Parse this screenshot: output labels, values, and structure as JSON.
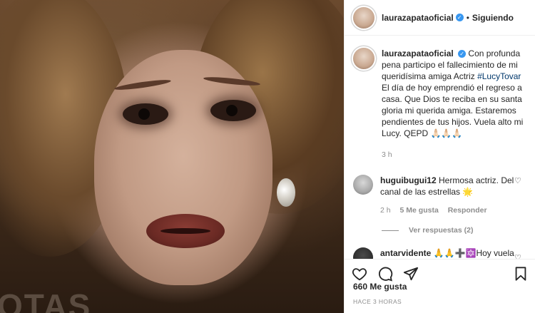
{
  "post": {
    "username": "laurazapataoficial",
    "follow_status": "Siguiendo",
    "dot": "•",
    "photo_watermark": "OTAS"
  },
  "caption": {
    "username": "laurazapataoficial",
    "text_before_tag": "Con profunda pena participo el fallecimiento de mi queridísima amiga Actriz ",
    "tag": "#LucyTovar",
    "text_after_tag": " El día de hoy emprendió el regreso a casa. Que Dios te reciba en su santa gloria mi querida amiga. Estaremos pendientes de tus hijos. Vuela alto mi Lucy. QEPD 🙏🏻🙏🏻🙏🏻",
    "time": "3 h"
  },
  "comments": [
    {
      "username": "huguibugui12",
      "text": " Hermosa actriz. Del canal de las estrellas 🌟",
      "time": "2 h",
      "likes": "5 Me gusta",
      "reply": "Responder",
      "view_replies": "Ver respuestas (2)"
    },
    {
      "username": "antarvidente",
      "text": " 🙏🙏➕🔯Hoy vuela alto aún llano de luz y colores,"
    }
  ],
  "footer": {
    "likes": "660 Me gusta",
    "time_ago": "HACE 3 HORAS"
  },
  "colors": {
    "verified": "#3897f0",
    "tag": "#00376b",
    "muted": "#8e8e8e"
  },
  "icons": [
    "verified-icon",
    "heart-icon",
    "comment-icon",
    "share-icon",
    "bookmark-icon"
  ]
}
